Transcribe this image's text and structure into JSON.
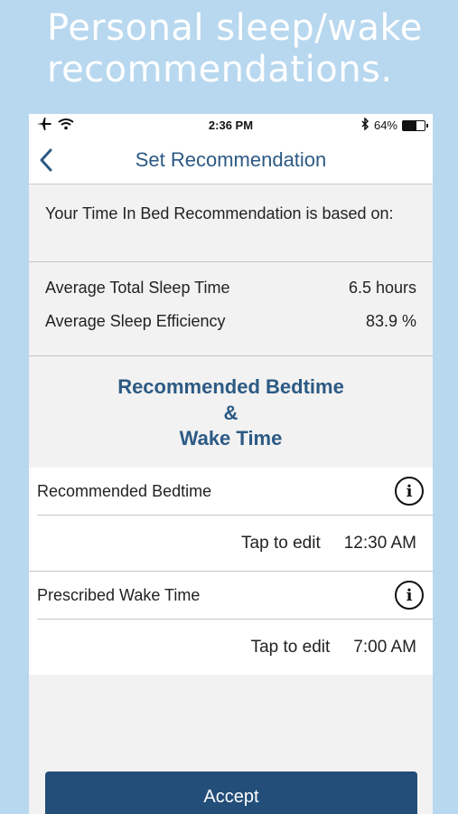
{
  "promo": {
    "headline": "Personal sleep/wake recommendations."
  },
  "status_bar": {
    "time": "2:36 PM",
    "battery_percent": "64%",
    "battery_level": 0.64
  },
  "nav": {
    "title": "Set Recommendation"
  },
  "basis": {
    "text": "Your Time In Bed Recommendation is based on:"
  },
  "stats": [
    {
      "label": "Average Total Sleep Time",
      "value": "6.5 hours"
    },
    {
      "label": "Average Sleep Efficiency",
      "value": "83.9 %"
    }
  ],
  "recommendation_heading": {
    "line1": "Recommended Bedtime",
    "line2": "&",
    "line3": "Wake Time"
  },
  "bedtime": {
    "label": "Recommended Bedtime",
    "edit_hint": "Tap to edit",
    "value": "12:30 AM",
    "info_glyph": "i"
  },
  "waketime": {
    "label": "Prescribed Wake Time",
    "edit_hint": "Tap to edit",
    "value": "7:00 AM",
    "info_glyph": "i"
  },
  "actions": {
    "accept_label": "Accept"
  },
  "colors": {
    "accent": "#2c5a84",
    "button": "#234e79",
    "background": "#b8d8ef"
  }
}
